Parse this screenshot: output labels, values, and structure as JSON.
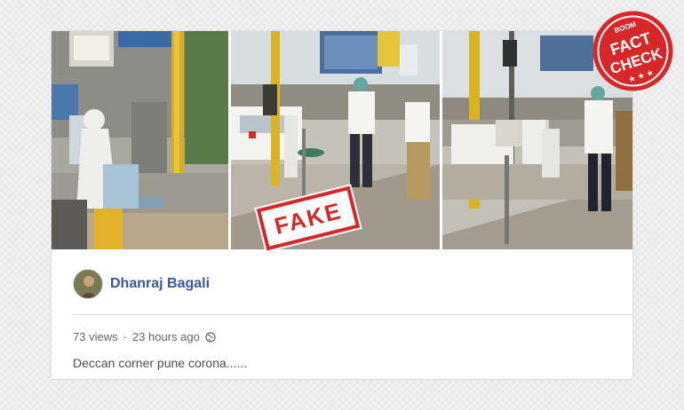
{
  "post": {
    "author": "Dhanraj Bagali",
    "views": "73 views",
    "separator": "·",
    "time": "23 hours ago",
    "caption": "Deccan corner pune corona......",
    "privacy_icon": "globe-icon"
  },
  "overlay": {
    "fake_stamp": "FAKE",
    "badge_top": "BOOM",
    "badge_line1": "FACT",
    "badge_line2": "CHECK"
  },
  "colors": {
    "author_link": "#385898",
    "stamp_red": "#d62828",
    "meta_gray": "#606770"
  }
}
